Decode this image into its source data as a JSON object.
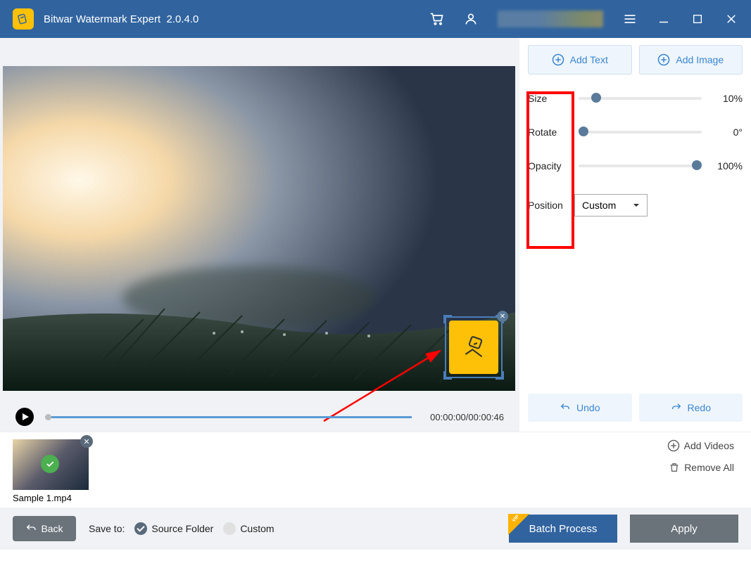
{
  "titlebar": {
    "app_name": "Bitwar Watermark Expert",
    "version": "2.0.4.0"
  },
  "toolbar": {
    "add_text_label": "Add Text",
    "add_image_label": "Add Image"
  },
  "properties": {
    "size": {
      "label": "Size",
      "value": "10%",
      "percent": 10
    },
    "rotate": {
      "label": "Rotate",
      "value": "0°",
      "percent": 0
    },
    "opacity": {
      "label": "Opacity",
      "value": "100%",
      "percent": 100
    },
    "position": {
      "label": "Position",
      "value": "Custom"
    }
  },
  "history": {
    "undo_label": "Undo",
    "redo_label": "Redo"
  },
  "timeline": {
    "time_display": "00:00:00/00:00:46"
  },
  "videos": {
    "item1": {
      "name": "Sample 1.mp4"
    },
    "add_label": "Add Videos",
    "remove_all_label": "Remove All"
  },
  "bottom": {
    "back_label": "Back",
    "save_to_label": "Save to:",
    "source_folder_label": "Source Folder",
    "custom_label": "Custom",
    "batch_label": "Batch Process",
    "apply_label": "Apply",
    "vip_label": "VIP"
  }
}
